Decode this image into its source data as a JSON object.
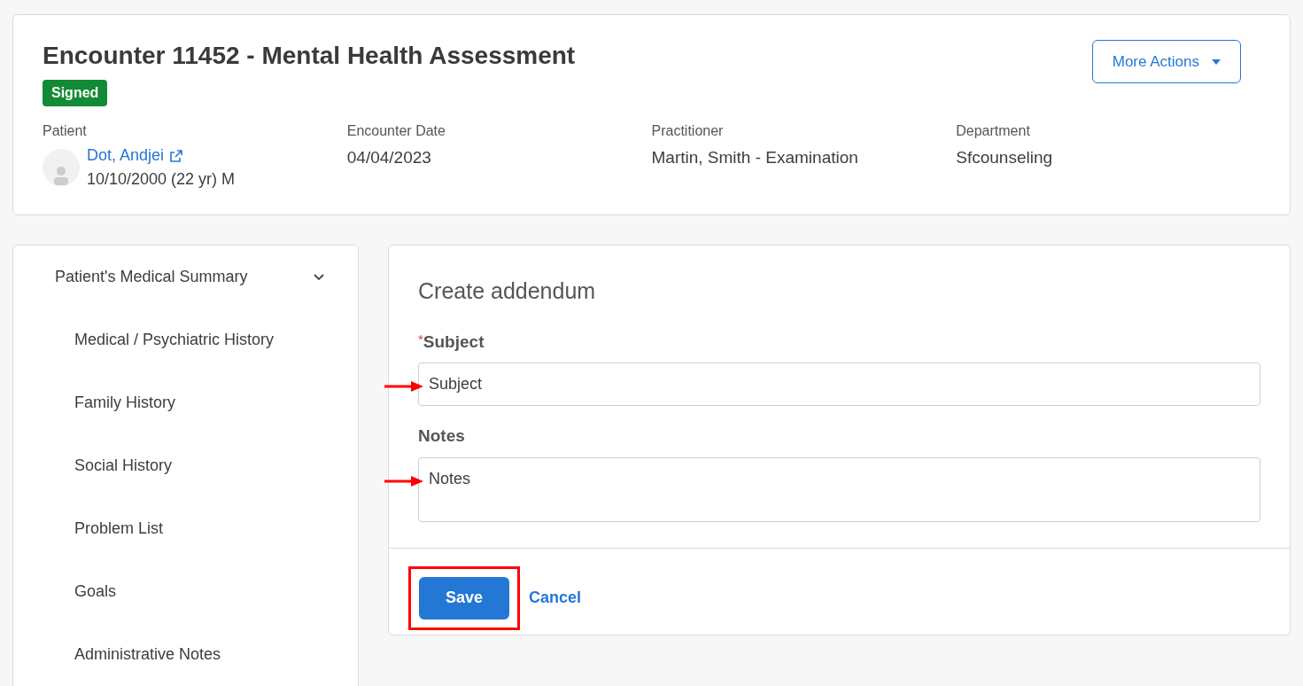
{
  "header": {
    "title": "Encounter 11452 - Mental Health Assessment",
    "status": "Signed",
    "more_actions": "More Actions",
    "fields": [
      {
        "kind": "patient",
        "label": "Patient",
        "name": "Dot, Andjei",
        "details": "10/10/2000 (22 yr) M"
      },
      {
        "kind": "text",
        "label": "Encounter Date",
        "value": "04/04/2023"
      },
      {
        "kind": "text",
        "label": "Practitioner",
        "value": "Martin, Smith - Examination"
      },
      {
        "kind": "text",
        "label": "Department",
        "value": "Sfcounseling"
      }
    ]
  },
  "sidebar": {
    "items": [
      {
        "label": "Patient's Medical Summary",
        "expanded": true,
        "children": [
          {
            "label": "Medical / Psychiatric History"
          },
          {
            "label": "Family History"
          },
          {
            "label": "Social History"
          },
          {
            "label": "Problem List"
          },
          {
            "label": "Goals"
          },
          {
            "label": "Administrative Notes"
          }
        ]
      }
    ]
  },
  "form": {
    "title": "Create addendum",
    "fields": [
      {
        "kind": "input",
        "label": "Subject",
        "required": true,
        "value": "Subject",
        "annotated": true
      },
      {
        "kind": "textarea",
        "label": "Notes",
        "required": false,
        "value": "Notes",
        "annotated": true
      }
    ],
    "required_marker": "*",
    "save": "Save",
    "save_highlighted": true,
    "cancel": "Cancel"
  }
}
